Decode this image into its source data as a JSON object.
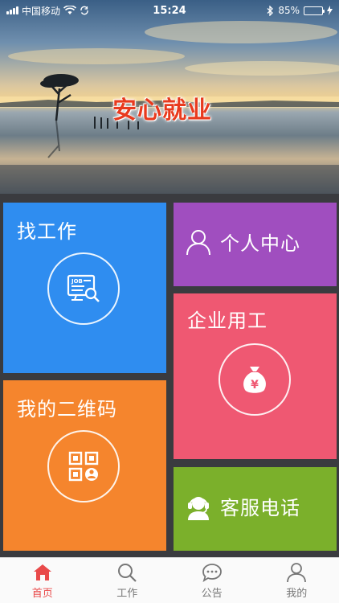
{
  "status_bar": {
    "carrier": "中国移动",
    "time": "15:24",
    "battery": "85%",
    "battery_level": 0.85
  },
  "banner": {
    "title": "安心就业"
  },
  "tiles": {
    "find_job": {
      "label": "找工作",
      "icon": "job-search-icon",
      "color": "#2f8df0"
    },
    "personal_center": {
      "label": "个人中心",
      "icon": "person-icon",
      "color": "#a04ebf"
    },
    "enterprise_hiring": {
      "label": "企业用工",
      "icon": "money-bag-icon",
      "color": "#ef5872"
    },
    "my_qrcode": {
      "label": "我的二维码",
      "icon": "qrcode-icon",
      "color": "#f5852d"
    },
    "customer_service": {
      "label": "客服电话",
      "icon": "headset-icon",
      "color": "#7bb02b"
    }
  },
  "tabbar": {
    "items": [
      {
        "label": "首页",
        "icon": "home-icon",
        "active": true
      },
      {
        "label": "工作",
        "icon": "search-icon",
        "active": false
      },
      {
        "label": "公告",
        "icon": "chat-icon",
        "active": false
      },
      {
        "label": "我的",
        "icon": "user-icon",
        "active": false
      }
    ],
    "active_color": "#e94a4a"
  }
}
